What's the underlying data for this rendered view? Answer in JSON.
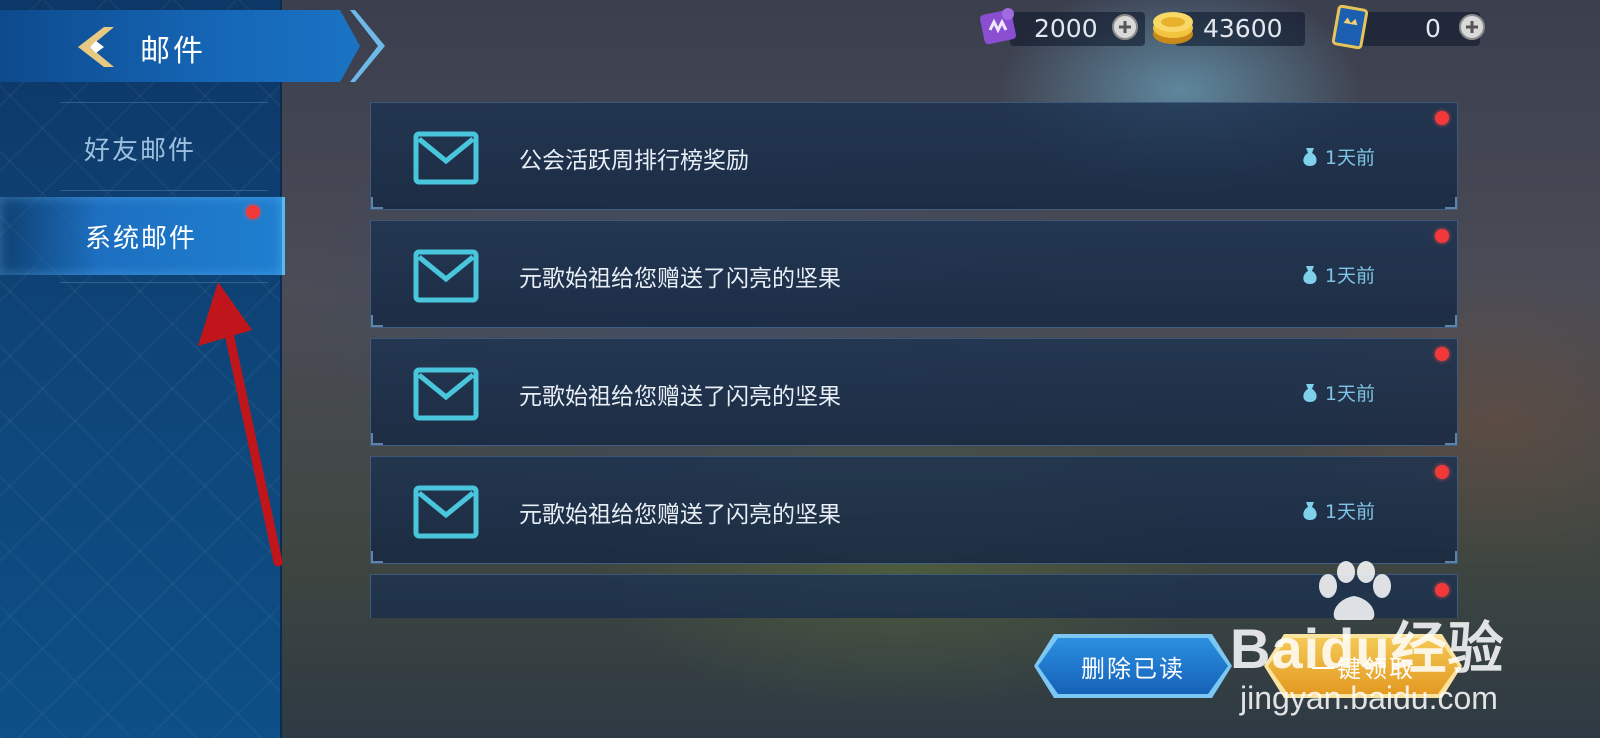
{
  "header": {
    "title": "邮件",
    "back_icon": "back-chevron-icon"
  },
  "currencies": [
    {
      "name": "puzzle-currency-icon",
      "value": "2000"
    },
    {
      "name": "gold-coin-icon",
      "value": "43600"
    },
    {
      "name": "ticket-card-icon",
      "value": "0"
    }
  ],
  "sidebar": {
    "tabs": [
      {
        "label": "好友邮件",
        "active": false
      },
      {
        "label": "系统邮件",
        "active": true,
        "has_badge": true
      }
    ]
  },
  "mails": [
    {
      "title": "公会活跃周排行榜奖励",
      "time": "1天前",
      "unread": true
    },
    {
      "title": "元歌始祖给您赠送了闪亮的坚果",
      "time": "1天前",
      "unread": true
    },
    {
      "title": "元歌始祖给您赠送了闪亮的坚果",
      "time": "1天前",
      "unread": true
    },
    {
      "title": "元歌始祖给您赠送了闪亮的坚果",
      "time": "1天前",
      "unread": true
    }
  ],
  "actions": {
    "delete_read": "删除已读",
    "claim_all": "一键领取"
  },
  "watermark": {
    "brand": "Baidu经验",
    "url": "jingyan.baidu.com"
  },
  "colors": {
    "accent_blue": "#1f7fd0",
    "unread_dot": "#f2393a",
    "mail_icon": "#49c6dc",
    "time_text": "#7fc4e4",
    "arrow": "#c0161b"
  }
}
